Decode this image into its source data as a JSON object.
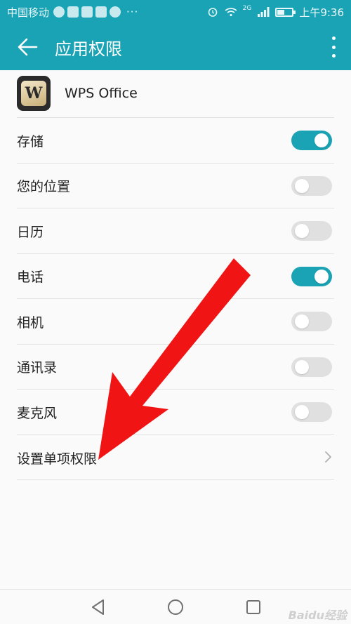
{
  "status_bar": {
    "carrier": "中国移动",
    "overflow": "···",
    "network": "2G",
    "time": "上午9:36",
    "battery_level": 0.45
  },
  "app_bar": {
    "title": "应用权限"
  },
  "app": {
    "name": "WPS Office",
    "icon_letter": "W"
  },
  "permissions": [
    {
      "label": "存储",
      "enabled": true
    },
    {
      "label": "您的位置",
      "enabled": false
    },
    {
      "label": "日历",
      "enabled": false
    },
    {
      "label": "电话",
      "enabled": true
    },
    {
      "label": "相机",
      "enabled": false
    },
    {
      "label": "通讯录",
      "enabled": false
    },
    {
      "label": "麦克风",
      "enabled": false
    }
  ],
  "single_permission": {
    "label": "设置单项权限"
  },
  "colors": {
    "accent": "#1aa3b5",
    "arrow": "#f01414"
  },
  "watermark": "Baidu经验"
}
